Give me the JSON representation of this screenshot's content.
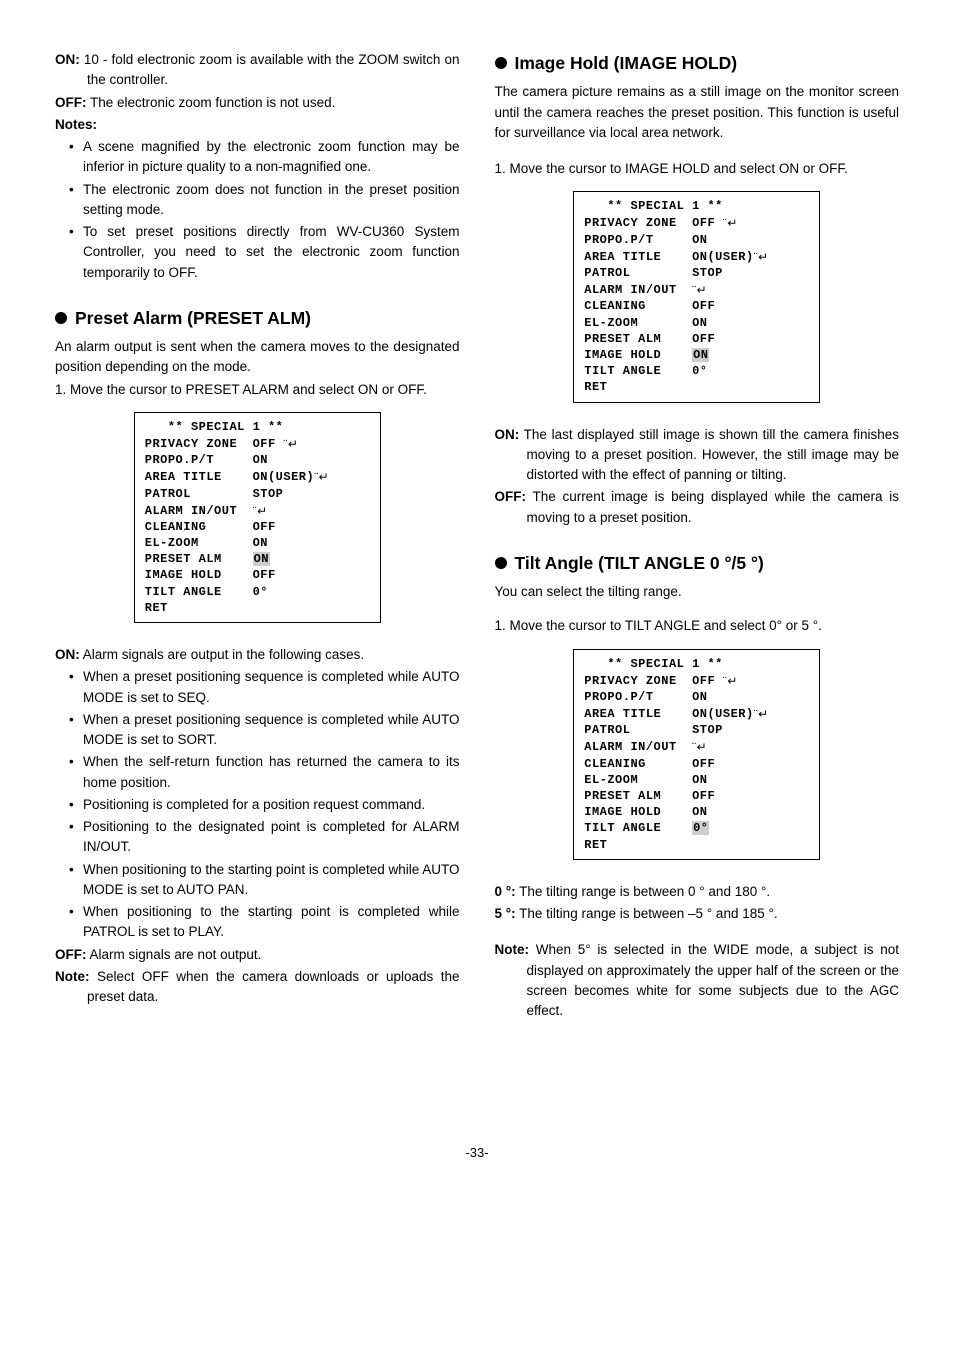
{
  "col1": {
    "on_desc": "10 - fold electronic zoom is available with the ZOOM switch on the controller.",
    "off_desc": "The electronic zoom function is not used.",
    "notes_label": "Notes:",
    "notes": [
      "A scene magnified by the electronic zoom function may be inferior in picture quality to a non-magnified one.",
      "The electronic zoom does not function in the preset position setting mode.",
      "To set preset positions directly from WV-CU360 System Controller, you need to set the electronic zoom function temporarily to OFF."
    ],
    "preset_heading": "Preset Alarm (PRESET ALM)",
    "preset_intro": "An alarm output is sent when the camera moves to the designated position depending on the mode.",
    "preset_step": "1. Move the cursor to PRESET ALARM and select ON or OFF.",
    "preset_on": "Alarm signals are output in the following cases.",
    "preset_cases": [
      "When a preset positioning sequence is completed while AUTO MODE is set to SEQ.",
      "When a preset positioning sequence is completed while AUTO MODE is set to SORT.",
      "When the self-return function has returned the camera to its home position.",
      "Positioning is completed for a position request command.",
      "Positioning to the designated point is completed for ALARM IN/OUT.",
      "When positioning to the starting point is completed while AUTO MODE is set to AUTO PAN.",
      "When positioning to the starting point is completed while PATROL is set to PLAY."
    ],
    "preset_off": "Alarm signals are not output.",
    "preset_note_label": "Note:",
    "preset_note": "Select OFF when the camera downloads or uploads the preset data."
  },
  "col2": {
    "image_heading": "Image Hold (IMAGE HOLD)",
    "image_intro": "The camera picture remains as a still image on the monitor screen until the camera reaches the preset position. This function is useful for surveillance via local area network.",
    "image_step": "1. Move the cursor to IMAGE HOLD and select ON or OFF.",
    "image_on": "The last displayed still image is shown till the camera finishes moving to a preset position. However, the still image may be distorted with the effect of panning or tilting.",
    "image_off": "The current image is being displayed while the camera is moving to a preset position.",
    "tilt_heading": "Tilt Angle (TILT ANGLE 0 °/5 °)",
    "tilt_intro": "You can select the tilting range.",
    "tilt_step": "1. Move the cursor to TILT ANGLE and select 0° or 5 °.",
    "tilt_0": "The tilting range is between 0 ° and 180 °.",
    "tilt_5": "The tilting range is between –5 ° and 185 °.",
    "tilt_note_label": "Note:",
    "tilt_note": "When 5° is selected in the WIDE mode, a subject is not displayed on approximately the upper half of the screen or the screen becomes white for some subjects due to the AGC effect."
  },
  "menu": {
    "title": "   ** SPECIAL 1 **",
    "r1": "PRIVACY ZONE  OFF",
    "r2": "PROPO.P/T     ON",
    "r3": "AREA TITLE    ON(USER)",
    "r4": "PATROL        STOP",
    "r5": "ALARM IN/OUT  ",
    "r6": "CLEANING      OFF",
    "r7": "EL-ZOOM       ON",
    "r8a_l": "PRESET ALM    ",
    "r8_off": "OFF",
    "r8_on": "ON",
    "r9a_l": "IMAGE HOLD    ",
    "r9_off": "OFF",
    "r9_on": "ON",
    "r10_l": "TILT ANGLE    ",
    "r10_v": "0°",
    "r11": "RET"
  },
  "labels": {
    "on": "ON:",
    "off": "OFF:",
    "zero": "0 °:",
    "five": "5 °:"
  },
  "page": "-33-"
}
